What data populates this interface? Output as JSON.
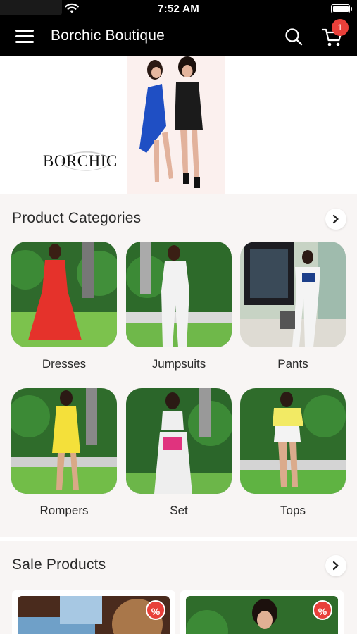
{
  "status_bar": {
    "time": "7:52 AM"
  },
  "header": {
    "title": "Borchic Boutique",
    "cart_count": "1"
  },
  "banner": {
    "brand_logo_text": "BORCHIC"
  },
  "categories_section": {
    "title": "Product Categories",
    "items": [
      {
        "label": "Dresses"
      },
      {
        "label": "Jumpsuits"
      },
      {
        "label": "Pants"
      },
      {
        "label": "Rompers"
      },
      {
        "label": "Set"
      },
      {
        "label": "Tops"
      }
    ]
  },
  "sale_section": {
    "title": "Sale Products",
    "items": [
      {
        "discount_badge": "%"
      },
      {
        "discount_badge": "%"
      }
    ]
  },
  "colors": {
    "header_bg": "#000000",
    "badge": "#e8403a",
    "section_bg": "#f8f5f4"
  },
  "icons": [
    "wifi-icon",
    "battery-icon",
    "menu-icon",
    "search-icon",
    "cart-icon",
    "chevron-right-icon"
  ]
}
